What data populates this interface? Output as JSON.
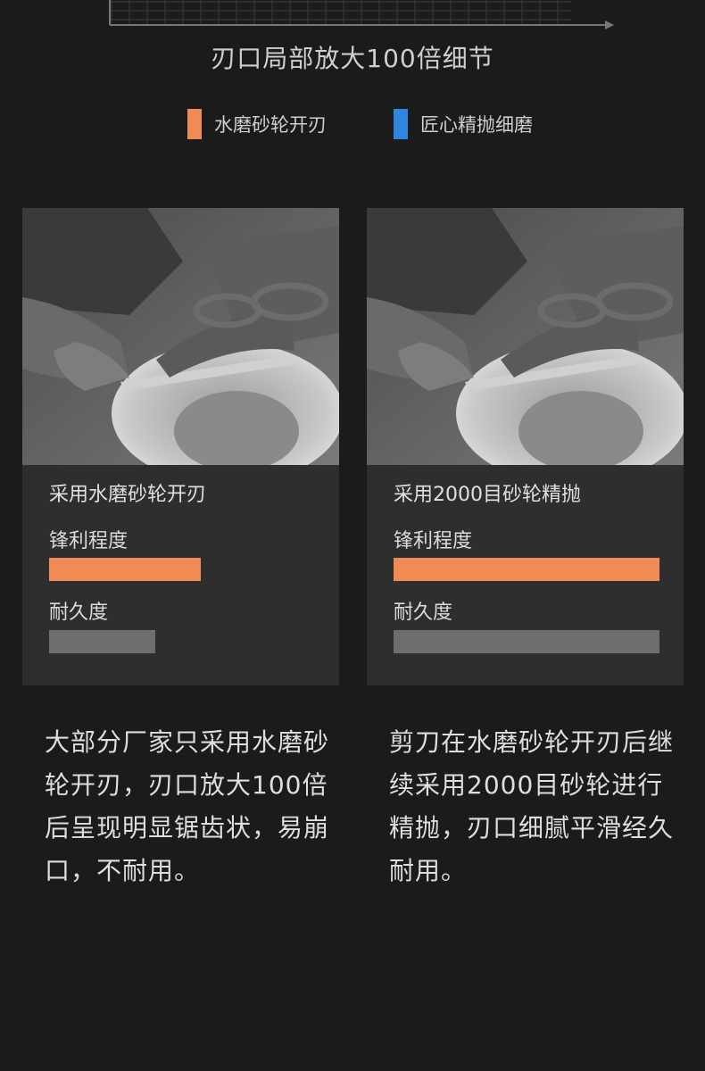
{
  "heading": "刃口局部放大100倍细节",
  "legend": [
    {
      "label": "水磨砂轮开刃",
      "color": "#f08b55"
    },
    {
      "label": "匠心精抛细磨",
      "color": "#2f86e0"
    }
  ],
  "cards": [
    {
      "method": "采用水磨砂轮开刃",
      "photo_icon": "grinding-scissors-photo",
      "metrics": [
        {
          "label": "锋利程度",
          "value": 0.57,
          "color": "#f08b55"
        },
        {
          "label": "耐久度",
          "value": 0.4,
          "color": "#6e6e6e"
        }
      ],
      "description": "大部分厂家只采用水磨砂轮开刃，刃口放大100倍后呈现明显锯齿状，易崩口，不耐用。"
    },
    {
      "method": "采用2000目砂轮精抛",
      "photo_icon": "grinding-scissors-photo",
      "metrics": [
        {
          "label": "锋利程度",
          "value": 1.0,
          "color": "#f08b55"
        },
        {
          "label": "耐久度",
          "value": 1.0,
          "color": "#6e6e6e"
        }
      ],
      "description": "剪刀在水磨砂轮开刃后继续采用2000目砂轮进行精抛，刃口细腻平滑经久耐用。"
    }
  ]
}
